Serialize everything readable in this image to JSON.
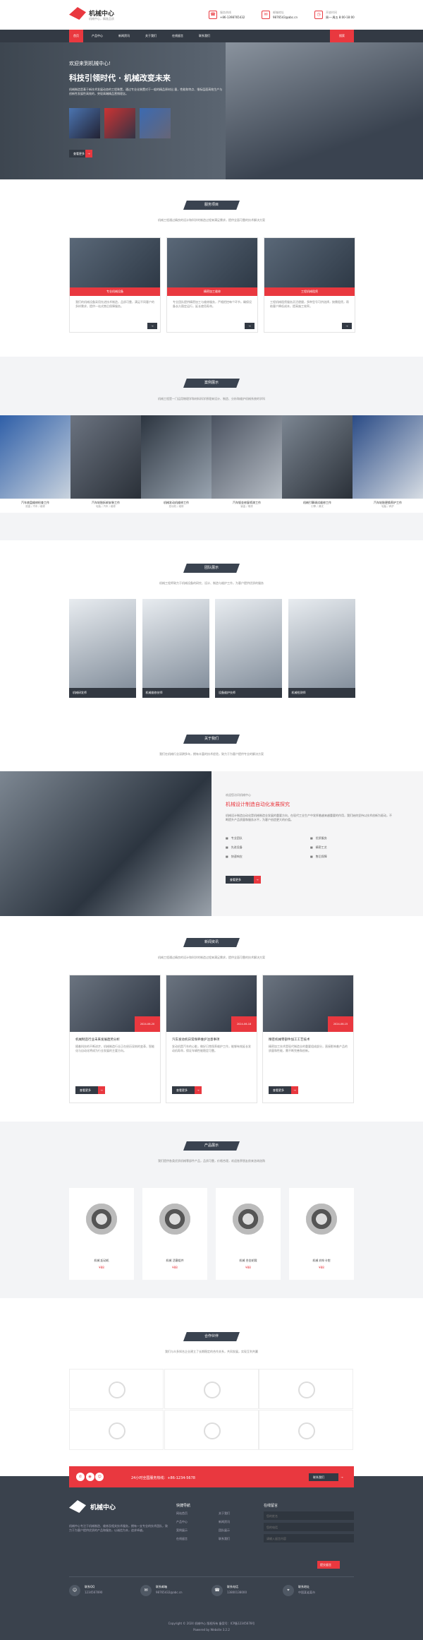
{
  "header": {
    "brand": "机械中心",
    "slogan": "机械中心，精准品质",
    "phone_label": "服务热线",
    "phone": "+86-1398765432",
    "email_label": "邮箱地址",
    "email": "9876543@abc.cn",
    "date_label": "开放时间",
    "date": "周一-周五 8:00-18:00"
  },
  "nav": {
    "items": [
      "首页",
      "产品中心",
      "新闻资讯",
      "关于我们",
      "在线留言",
      "联系我们"
    ],
    "search": "搜索"
  },
  "hero": {
    "welcome": "欢迎来到机械中心!",
    "title": "科技引领时代 · 机械改变未来",
    "desc": "机械制造是基于新技术发展动态的工程装置，通过专业化装置对于一般的精品原材出 量，性能和特点、指标层面高效生产与创新性发展性高效的，突现高端精品营销理念。",
    "button": "查看更多"
  },
  "services": {
    "title": "服务项目",
    "subtitle": "机械工程通过精良的设计和科学的制造过程来满足需求，提供全面可靠的技术解决方案",
    "items": [
      {
        "label": "专业机械设备",
        "desc": "我们的机械设备采用先进技术制造，品质可靠，满足不同客户的多样需求，提供一站式售后保障服务。"
      },
      {
        "label": "精密加工维修",
        "desc": "专业团队提供精密加工与维修服务，严格把控每个环节，确保设备长久稳定运行，延长使用寿命。"
      },
      {
        "label": "工程机械租赁",
        "desc": "工程机械租赁服务灵活便捷，多种型号可供选择，按需租赁，帮助客户降低成本，提高施工效率。"
      }
    ]
  },
  "cases": {
    "title": "案例展示",
    "subtitle": "机械工程是一门运用物理学和材料科学原理来设计、制造、分析和维护机械系统的学科",
    "items": [
      {
        "t": "汽车底盘维修检查工作",
        "s": "底盘 / 汽车 / 维修"
      },
      {
        "t": "汽车轮胎拆卸安装工作",
        "s": "轮胎 / 汽车 / 维修"
      },
      {
        "t": "机械发动机维修工作",
        "s": "发动机 / 维修"
      },
      {
        "t": "汽车钣金修复喷漆工作",
        "s": "钣金 / 喷漆"
      },
      {
        "t": "机械引擎调试维修工作",
        "s": "引擎 / 调试"
      },
      {
        "t": "汽车轮胎更换养护工作",
        "s": "轮胎 / 养护"
      }
    ]
  },
  "team": {
    "title": "团队展示",
    "subtitle": "机械工程师致力于机械设备的研究、设计、制造与维护工作，为客户提供优质的服务",
    "members": [
      "机械研发师",
      "机械维修技师",
      "设备维护技师",
      "机械检测师"
    ]
  },
  "about": {
    "title": "关于我们",
    "subtitle": "我们在机械行业深耕多年，拥有丰富的技术经验，致力于为客户提供专业的解决方案",
    "welcome": "欢迎您访问机械中心",
    "heading": "机械设计制造自动化发展探究",
    "desc": "机械设计制造自动化是机械制造业发展的重要方向，在现代工业生产中发挥着越来越重要的作用，我们始终坚持以技术创新为驱动，不断提升产品质量和服务水平，为客户创造更大的价值。",
    "features": [
      "专业团队",
      "优质服务",
      "先进设备",
      "精密工艺",
      "快速响应",
      "售后保障"
    ],
    "button": "查看更多"
  },
  "news": {
    "title": "新闻资讯",
    "subtitle": "机械工程通过精良的设计和科学的制造过程来满足需求，提供全面可靠的技术解决方案",
    "items": [
      {
        "t": "机械制造行业未来发展趋势分析",
        "d": "随着科技的不断进步，机械制造行业正在经历深刻的变革，智能化与自动化将成为行业发展的主要方向。",
        "date": "2024-06-20"
      },
      {
        "t": "汽车发动机日常保养维护注意事项",
        "d": "发动机是汽车的心脏，做好日常保养维护工作，能够有效延长发动机寿命，保证车辆性能稳定可靠。",
        "date": "2024-06-18"
      },
      {
        "t": "精密机械零部件加工工艺技术",
        "d": "精密加工技术是现代制造业的重要组成部分，直接影响着产品的质量和性能，需不断完善和创新。",
        "date": "2024-06-15"
      }
    ],
    "button": "查看更多"
  },
  "products": {
    "title": "产品展示",
    "subtitle": "我们提供各类优质机械零部件产品，品质可靠，价格合理，欢迎各界朋友前来咨询选购",
    "items": [
      {
        "name": "机械 起动机",
        "price": "¥88"
      },
      {
        "name": "机械 活塞组件",
        "price": "¥88"
      },
      {
        "name": "机械 合金轮毂",
        "price": "¥88"
      },
      {
        "name": "机械 刹车卡钳",
        "price": "¥88"
      }
    ]
  },
  "partners": {
    "title": "合作伙伴",
    "subtitle": "我们与众多知名企业建立了长期稳定的合作关系，共同发展，实现互利共赢"
  },
  "cta": {
    "text": "24小时全国服务热线：+86-1234-5678",
    "button": "联系我们"
  },
  "footer": {
    "brand": "机械中心",
    "desc": "机械中心专注于机械制造、维修及相关技术服务，拥有一支专业的技术团队，致力于为客户提供优质的产品和服务，以诚信为本，追求卓越。",
    "links_title": "快捷导航",
    "links": [
      "网站首页",
      "关于我们",
      "产品中心",
      "新闻资讯",
      "案例展示",
      "团队展示",
      "在线留言",
      "联系我们"
    ],
    "msg_title": "在线留言",
    "msg_fields": [
      "您的姓名",
      "您的电话",
      "请输入留言内容"
    ],
    "submit": "提交留言",
    "contacts": [
      {
        "label": "联系QQ",
        "value": "1234567890"
      },
      {
        "label": "联系邮箱",
        "value": "98765432@abc.cn"
      },
      {
        "label": "联系电话",
        "value": "13800138000"
      },
      {
        "label": "联系地址",
        "value": "中国某省某市"
      }
    ],
    "copyright": "Copyright © 2024 机械中心 版权所有 备案号：ICP备12345678号",
    "powered": "Powered by Website 3.2.2"
  }
}
